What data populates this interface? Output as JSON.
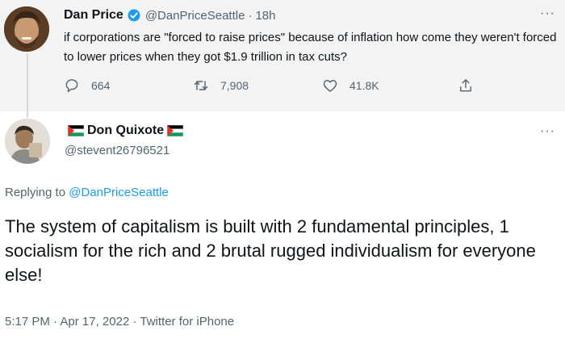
{
  "parent_tweet": {
    "author_name": "Dan Price",
    "handle": "@DanPriceSeattle",
    "separator": "·",
    "time": "18h",
    "text": "if corporations are \"forced to raise prices\" because of inflation how come they weren't forced to lower prices when they got $1.9 trillion in tax cuts?",
    "more": "···",
    "actions": {
      "replies": "664",
      "retweets": "7,908",
      "likes": "41.8K"
    }
  },
  "reply_tweet": {
    "author_name": "Don Quixote",
    "handle": "@stevent26796521",
    "more": "···",
    "replying_prefix": "Replying to",
    "replying_to": "@DanPriceSeattle",
    "text": "The system of capitalism is built with 2 fundamental principles, 1 socialism for the rich and 2 brutal rugged individualism for everyone else!",
    "time": "5:17 PM",
    "separator": "·",
    "date": "Apr 17, 2022",
    "source": "Twitter for iPhone"
  },
  "colors": {
    "link_blue": "#1d9bf0",
    "secondary_text": "#536471",
    "parent_background": "#f3f3f3"
  },
  "icons": [
    "verified-badge-icon",
    "reply-icon",
    "retweet-icon",
    "like-icon",
    "share-icon",
    "more-icon",
    "flag-icon"
  ]
}
